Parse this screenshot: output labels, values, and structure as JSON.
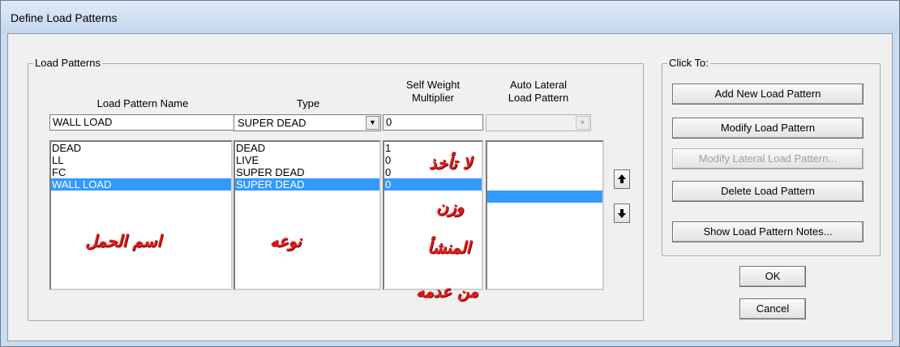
{
  "window": {
    "title": "Define Load Patterns"
  },
  "load_patterns_group": {
    "legend": "Load Patterns",
    "headers": {
      "name": "Load Pattern Name",
      "type": "Type",
      "self_weight_line1": "Self Weight",
      "self_weight_line2": "Multiplier",
      "auto_lateral_line1": "Auto Lateral",
      "auto_lateral_line2": "Load Pattern"
    },
    "inputs": {
      "name_value": "WALL LOAD",
      "type_value": "SUPER DEAD",
      "self_weight_value": "0",
      "auto_lateral_value": ""
    },
    "rows": [
      {
        "name": "DEAD",
        "type": "DEAD",
        "multiplier": "1"
      },
      {
        "name": "LL",
        "type": "LIVE",
        "multiplier": "0"
      },
      {
        "name": "FC",
        "type": "SUPER DEAD",
        "multiplier": "0"
      },
      {
        "name": "WALL LOAD",
        "type": "SUPER DEAD",
        "multiplier": "0"
      }
    ],
    "selected_row_index": 3
  },
  "click_to_group": {
    "legend": "Click To:",
    "add_new": "Add New Load Pattern",
    "modify": "Modify Load Pattern",
    "modify_lateral": "Modify Lateral Load Pattern...",
    "delete": "Delete Load Pattern",
    "show_notes": "Show Load Pattern Notes..."
  },
  "dialog_buttons": {
    "ok": "OK",
    "cancel": "Cancel"
  },
  "annotations": {
    "name_note": "اسم الحمل",
    "type_note": "نوعه",
    "weight_note_1": "لا تأخذ",
    "weight_note_2": "وزن",
    "weight_note_3": "المنشأ",
    "weight_note_4": "من عدمه"
  },
  "icons": {
    "combo_arrow": "chevron-down-icon",
    "move_up": "arrow-up-icon",
    "move_down": "arrow-down-icon"
  },
  "colors": {
    "selection": "#3399ff",
    "annotation_red": "#e21a1a",
    "titlebar": "#c9dcf0"
  }
}
